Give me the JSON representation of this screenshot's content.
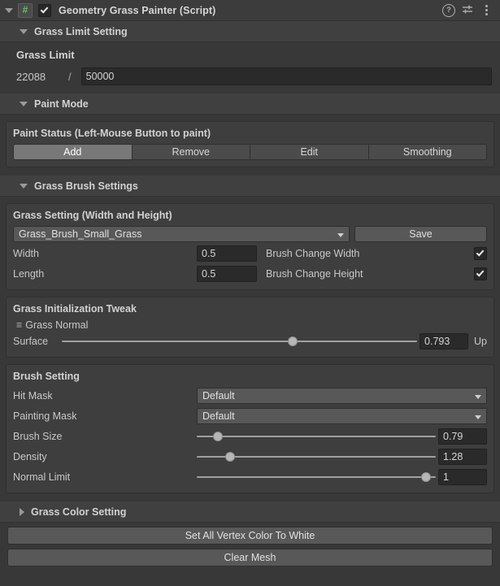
{
  "header": {
    "title": "Geometry Grass Painter (Script)",
    "script_icon": "#",
    "enabled_checkbox": true,
    "help_icon": "?",
    "preset_icon": "preset-icon",
    "menu_icon": "kebab-menu-icon"
  },
  "grass_limit_section": {
    "title": "Grass Limit Setting",
    "expanded": true,
    "label": "Grass Limit",
    "current": "22088",
    "separator": "/",
    "max_value": "50000"
  },
  "paint_mode_section": {
    "title": "Paint Mode",
    "expanded": true,
    "panel_title": "Paint Status (Left-Mouse Button to paint)",
    "modes": [
      {
        "label": "Add",
        "active": true
      },
      {
        "label": "Remove",
        "active": false
      },
      {
        "label": "Edit",
        "active": false
      },
      {
        "label": "Smoothing",
        "active": false
      }
    ]
  },
  "grass_brush_section": {
    "title": "Grass Brush Settings",
    "expanded": true,
    "grass_setting": {
      "panel_title": "Grass Setting (Width and Height)",
      "preset_value": "Grass_Brush_Small_Grass",
      "save_label": "Save",
      "rows": [
        {
          "name": "Width",
          "value": "0.5",
          "check_label": "Brush Change Width",
          "checked": true
        },
        {
          "name": "Length",
          "value": "0.5",
          "check_label": "Brush Change Height",
          "checked": true
        }
      ]
    },
    "init_tweak": {
      "panel_title": "Grass Initialization Tweak",
      "normal_label": "Grass Normal",
      "surface_label": "Surface",
      "surface_value": "0.793",
      "surface_percent": 65,
      "up_label": "Up"
    },
    "brush_setting": {
      "panel_title": "Brush Setting",
      "hit_mask_label": "Hit Mask",
      "hit_mask_value": "Default",
      "painting_mask_label": "Painting Mask",
      "painting_mask_value": "Default",
      "sliders": [
        {
          "name": "Brush Size",
          "value": "0.79",
          "percent": 9
        },
        {
          "name": "Density",
          "value": "1.28",
          "percent": 14
        },
        {
          "name": "Normal Limit",
          "value": "1",
          "percent": 96
        }
      ]
    }
  },
  "grass_color_section": {
    "title": "Grass Color Setting",
    "expanded": false
  },
  "actions": {
    "set_white_label": "Set All Vertex Color To White",
    "clear_mesh_label": "Clear Mesh"
  }
}
